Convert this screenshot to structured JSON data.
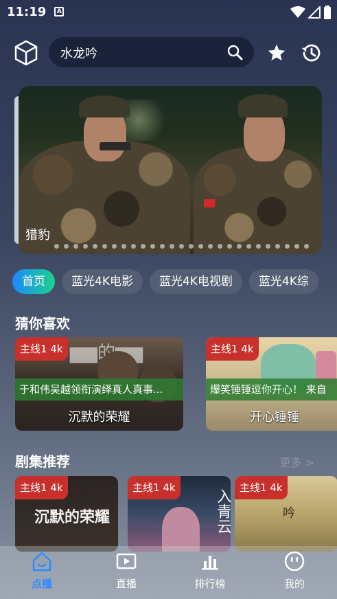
{
  "status_bar": {
    "time": "11:19",
    "notif_icon": "A"
  },
  "search": {
    "query": "水龙吟"
  },
  "banner": {
    "caption": "猎豹",
    "dot_count": 27
  },
  "categories": [
    {
      "label": "首页",
      "active": true
    },
    {
      "label": "蓝光4K电影",
      "active": false
    },
    {
      "label": "蓝光4K电视剧",
      "active": false
    },
    {
      "label": "蓝光4K综",
      "active": false
    }
  ],
  "guess": {
    "title": "猜你喜欢",
    "cards": [
      {
        "badge": "主线1  4k",
        "desc": "于和伟吴越领衔演绎真人真事...",
        "title": "沉默的荣耀"
      },
      {
        "badge": "主线1  4k",
        "desc": "爆笑锤锤逗你开心！ 来自",
        "title": "开心锤锤"
      }
    ]
  },
  "series": {
    "title": "剧集推荐",
    "more": "更多 >",
    "cards": [
      {
        "badge": "主线1  4k",
        "poster_text": "沉默的荣耀"
      },
      {
        "badge": "主线1  4k",
        "poster_text": "入青云"
      },
      {
        "badge": "主线1  4k",
        "poster_text": "吟"
      }
    ]
  },
  "nav": {
    "items": [
      {
        "label": "点播",
        "icon": "home-icon",
        "active": true
      },
      {
        "label": "直播",
        "icon": "play-screen-icon",
        "active": false
      },
      {
        "label": "排行榜",
        "icon": "bar-chart-icon",
        "active": false
      },
      {
        "label": "我的",
        "icon": "smile-icon",
        "active": false
      }
    ]
  },
  "colors": {
    "accent": "#2e8cff",
    "badge": "#c8302c",
    "chip_active_start": "#1e88ff",
    "chip_active_end": "#19d38a"
  }
}
